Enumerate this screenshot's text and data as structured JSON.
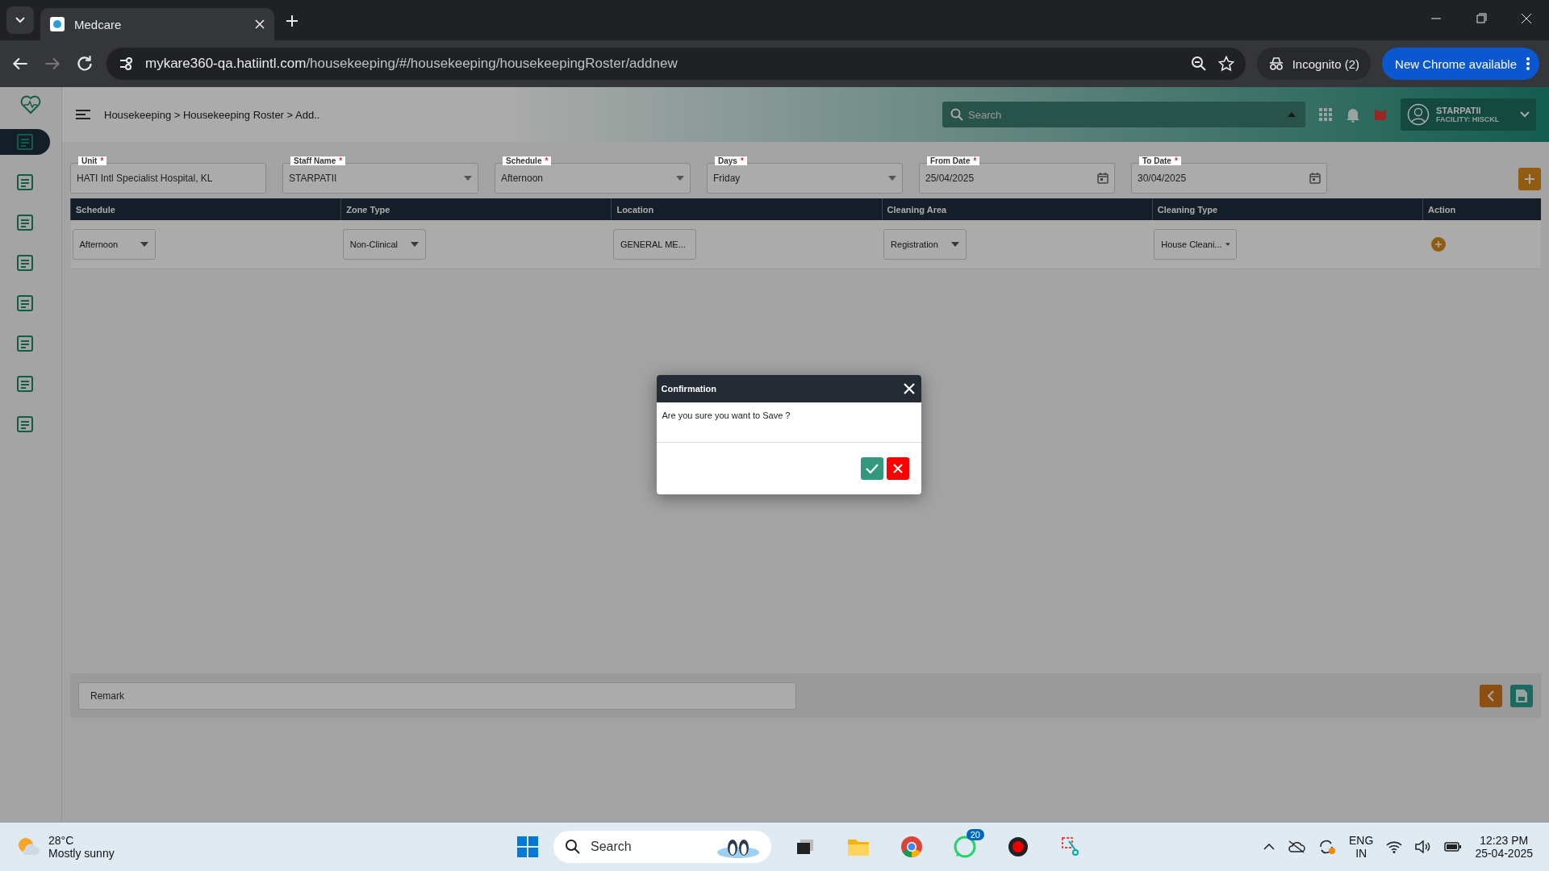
{
  "browser": {
    "tab_title": "Medcare",
    "url_host": "mykare360-qa.hatiintl.com",
    "url_path": "/housekeeping/#/housekeeping/housekeepingRoster/addnew",
    "incognito": "Incognito (2)",
    "update_button": "New Chrome available"
  },
  "sidebar": {
    "items": [
      {
        "selected": true
      },
      {
        "selected": false
      },
      {
        "selected": false
      },
      {
        "selected": false
      },
      {
        "selected": false
      },
      {
        "selected": false
      },
      {
        "selected": false
      },
      {
        "selected": false
      }
    ]
  },
  "header": {
    "breadcrumb": "Housekeeping > Housekeeping Roster > Add..",
    "search_placeholder": "Search",
    "user_name": "STARPATII",
    "facility": "FACILITY: HISCKL"
  },
  "form": {
    "fields": [
      {
        "label": "Unit",
        "required_mark": "*",
        "value": "HATI Intl Specialist Hospital, KL",
        "kind": "text"
      },
      {
        "label": "Staff Name",
        "required_mark": "*",
        "value": "STARPATII",
        "kind": "select"
      },
      {
        "label": "Schedule",
        "required_mark": "*",
        "value": "Afternoon",
        "kind": "select"
      },
      {
        "label": "Days",
        "required_mark": "*",
        "value": "Friday",
        "kind": "select"
      },
      {
        "label": "From Date",
        "required_mark": "*",
        "value": "25/04/2025",
        "kind": "date"
      },
      {
        "label": "To Date",
        "required_mark": "*",
        "value": "30/04/2025",
        "kind": "date"
      }
    ]
  },
  "table": {
    "columns": [
      "Schedule",
      "Zone Type",
      "Location",
      "Cleaning Area",
      "Cleaning Type",
      "Action"
    ],
    "rows": [
      {
        "cells": [
          "Afternoon",
          "Non-Clinical",
          "GENERAL ME...",
          "Registration",
          "House Cleani..."
        ]
      }
    ]
  },
  "remark": {
    "placeholder": "Remark"
  },
  "dialog": {
    "title": "Confirmation",
    "message": "Are you sure you want to Save ?"
  },
  "taskbar": {
    "temperature": "28°C",
    "weather": "Mostly sunny",
    "search": "Search",
    "whatsapp_badge": "20",
    "language": "ENG",
    "region": "IN",
    "time": "12:23 PM",
    "date": "25-04-2025"
  }
}
